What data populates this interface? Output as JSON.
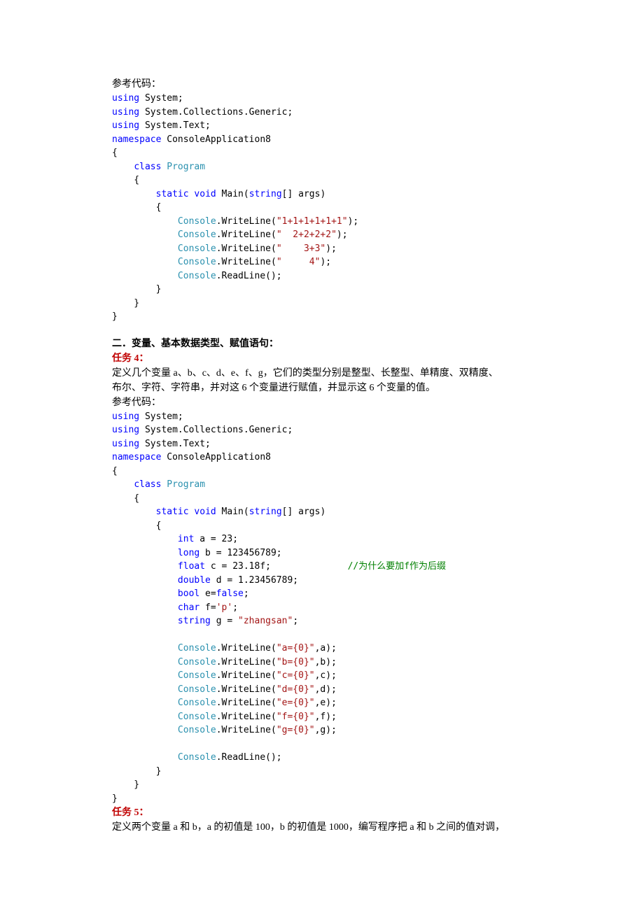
{
  "code1": {
    "intro": "参考代码：",
    "u1": "using",
    "sys": " System;",
    "gen": " System.Collections.Generic;",
    "txt": " System.Text;",
    "ns": "namespace",
    "nsName": " ConsoleApplication8",
    "cls": "class",
    "prog": "Program",
    "static": "static",
    "void": "void",
    "main": " Main(",
    "string": "string",
    "args": "[] args)",
    "console": "Console",
    "wl": ".WriteLine(",
    "rl": ".ReadLine();",
    "s1": "\"1+1+1+1+1+1\"",
    "s2": "\"  2+2+2+2\"",
    "s3": "\"    3+3\"",
    "s4": "\"     4\"",
    "close": ");"
  },
  "section2": "二．变量、基本数据类型、赋值语句：",
  "task4": {
    "label": "任务 4：",
    "desc1": "定义几个变量 a、b、c、d、e、f、g，它们的类型分别是整型、长整型、单精度、双精度、",
    "desc2": "布尔、字符、字符串，并对这 6 个变量进行赋值，并显示这 6 个变量的值。",
    "ref": "参考代码："
  },
  "code2": {
    "int": "int",
    "a": " a = 23;",
    "long": "long",
    "b": " b = 123456789;",
    "float": "float",
    "c": " c = 23.18f;",
    "comment": "//为什么要加f作为后缀",
    "double": "double",
    "d": " d = 1.23456789;",
    "bool": "bool",
    "e": " e=",
    "false": "false",
    "semi": ";",
    "char": "char",
    "f": " f=",
    "fval": "'p'",
    "string": "string",
    "g": " g = ",
    "gval": "\"zhangsan\"",
    "wa": "\"a={0}\"",
    "wb": "\"b={0}\"",
    "wc": "\"c={0}\"",
    "wd": "\"d={0}\"",
    "we": "\"e={0}\"",
    "wf": "\"f={0}\"",
    "wg": "\"g={0}\"",
    "comma_a": ",a);",
    "comma_b": ",b);",
    "comma_c": ",c);",
    "comma_d": ",d);",
    "comma_e": ",e);",
    "comma_f": ",f);",
    "comma_g": ",g);"
  },
  "task5": {
    "label": "任务 5：",
    "desc": "定义两个变量 a 和 b，a 的初值是 100，b 的初值是 1000，编写程序把 a 和 b 之间的值对调，"
  }
}
